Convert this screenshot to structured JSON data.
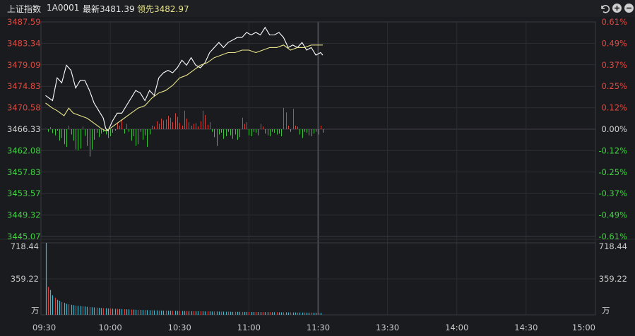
{
  "header": {
    "title": "上证指数",
    "code": "1A0001",
    "latest_label": "最新",
    "latest_value": "3481.39",
    "leading_label": "领先",
    "leading_value": "3482.97",
    "icons": [
      "undo-icon",
      "zoom-in-icon",
      "zoom-out-icon"
    ]
  },
  "chart_data": {
    "type": "line",
    "prev_close": 3466.33,
    "price_axis_labels": [
      "3487.59",
      "3483.34",
      "3479.09",
      "3474.83",
      "3470.58",
      "3466.33",
      "3462.08",
      "3457.83",
      "3453.57",
      "3449.32",
      "3445.07"
    ],
    "pct_axis_labels": [
      "0.61%",
      "0.49%",
      "0.37%",
      "0.25%",
      "0.12%",
      "0.00%",
      "-0.12%",
      "-0.25%",
      "-0.37%",
      "-0.49%",
      "-0.61%"
    ],
    "ylim": [
      3445.07,
      3487.59
    ],
    "volume_axis_labels": [
      "718.44",
      "359.22"
    ],
    "volume_unit": "万",
    "volume_ylim": [
      0,
      718.44
    ],
    "time_labels": [
      "09:30",
      "10:00",
      "10:30",
      "11:00",
      "11:30",
      "13:30",
      "14:00",
      "14:30",
      "15:00"
    ],
    "session_minutes": 240,
    "series": [
      {
        "color": "#ffffff",
        "points": [
          [
            0,
            3473.0
          ],
          [
            3,
            3472.0
          ],
          [
            5,
            3476.5
          ],
          [
            7,
            3475.5
          ],
          [
            9,
            3479.0
          ],
          [
            11,
            3478.0
          ],
          [
            13,
            3474.5
          ],
          [
            15,
            3476.0
          ],
          [
            17,
            3476.0
          ],
          [
            19,
            3474.0
          ],
          [
            21,
            3471.5
          ],
          [
            23,
            3470.0
          ],
          [
            25,
            3468.5
          ],
          [
            26,
            3466.5
          ],
          [
            27,
            3466.0
          ],
          [
            29,
            3468.0
          ],
          [
            31,
            3469.5
          ],
          [
            33,
            3469.5
          ],
          [
            35,
            3471.0
          ],
          [
            37,
            3472.5
          ],
          [
            39,
            3474.0
          ],
          [
            41,
            3473.5
          ],
          [
            43,
            3472.0
          ],
          [
            45,
            3474.0
          ],
          [
            47,
            3473.0
          ],
          [
            49,
            3476.5
          ],
          [
            51,
            3477.5
          ],
          [
            53,
            3478.0
          ],
          [
            55,
            3477.5
          ],
          [
            57,
            3478.5
          ],
          [
            59,
            3480.0
          ],
          [
            61,
            3479.0
          ],
          [
            63,
            3480.5
          ],
          [
            65,
            3479.0
          ],
          [
            67,
            3478.5
          ],
          [
            69,
            3479.5
          ],
          [
            71,
            3481.5
          ],
          [
            73,
            3482.5
          ],
          [
            75,
            3483.5
          ],
          [
            77,
            3482.5
          ],
          [
            79,
            3483.5
          ],
          [
            81,
            3484.0
          ],
          [
            83,
            3484.5
          ],
          [
            85,
            3484.5
          ],
          [
            87,
            3485.5
          ],
          [
            89,
            3485.0
          ],
          [
            91,
            3485.5
          ],
          [
            93,
            3485.0
          ],
          [
            95,
            3486.5
          ],
          [
            97,
            3485.0
          ],
          [
            99,
            3485.0
          ],
          [
            101,
            3485.5
          ],
          [
            103,
            3484.5
          ],
          [
            105,
            3482.5
          ],
          [
            107,
            3483.0
          ],
          [
            109,
            3482.5
          ],
          [
            111,
            3483.5
          ],
          [
            113,
            3482.0
          ],
          [
            115,
            3482.5
          ],
          [
            117,
            3481.0
          ],
          [
            119,
            3481.5
          ],
          [
            120,
            3481.0
          ]
        ]
      },
      {
        "color": "#e8e48c",
        "points": [
          [
            0,
            3471.5
          ],
          [
            3,
            3470.5
          ],
          [
            5,
            3470.0
          ],
          [
            8,
            3469.0
          ],
          [
            10,
            3470.5
          ],
          [
            12,
            3469.5
          ],
          [
            15,
            3469.0
          ],
          [
            18,
            3468.5
          ],
          [
            21,
            3467.5
          ],
          [
            24,
            3466.5
          ],
          [
            26,
            3466.0
          ],
          [
            28,
            3466.5
          ],
          [
            31,
            3467.5
          ],
          [
            34,
            3468.5
          ],
          [
            37,
            3469.5
          ],
          [
            40,
            3470.5
          ],
          [
            43,
            3471.0
          ],
          [
            46,
            3472.5
          ],
          [
            49,
            3473.5
          ],
          [
            52,
            3474.0
          ],
          [
            55,
            3475.0
          ],
          [
            58,
            3476.5
          ],
          [
            61,
            3477.0
          ],
          [
            64,
            3478.0
          ],
          [
            67,
            3479.0
          ],
          [
            70,
            3479.5
          ],
          [
            73,
            3480.5
          ],
          [
            76,
            3481.0
          ],
          [
            79,
            3481.5
          ],
          [
            82,
            3481.5
          ],
          [
            85,
            3482.0
          ],
          [
            88,
            3482.0
          ],
          [
            91,
            3481.5
          ],
          [
            94,
            3482.0
          ],
          [
            97,
            3482.5
          ],
          [
            100,
            3482.5
          ],
          [
            103,
            3483.0
          ],
          [
            106,
            3482.0
          ],
          [
            109,
            3482.5
          ],
          [
            112,
            3482.5
          ],
          [
            115,
            3483.0
          ],
          [
            118,
            3483.0
          ],
          [
            120,
            3483.0
          ]
        ]
      }
    ],
    "imbalance_bars": [
      -1.5,
      1.2,
      -2.2,
      -3.5,
      -0.8,
      -6.5,
      -5.0,
      -8.5,
      -10.0,
      2.0,
      -3.0,
      -6.5,
      -11.5,
      -12.0,
      -11.0,
      1.5,
      -3.8,
      -9.5,
      -15.5,
      -11.5,
      -6.0,
      -2.0,
      -4.5,
      -2.5,
      -1.5,
      -3.0,
      -5.0,
      -4.0,
      -2.0,
      -0.8,
      3.5,
      2.0,
      5.0,
      -2.5,
      3.0,
      -1.5,
      -6.5,
      -4.0,
      -9.5,
      -8.5,
      -1.5,
      -6.0,
      -3.5,
      -10.0,
      -3.0,
      2.0,
      1.5,
      4.5,
      3.0,
      6.0,
      5.0,
      5.5,
      7.5,
      6.5,
      4.0,
      9.0,
      7.0,
      3.5,
      2.0,
      10.5,
      6.0,
      4.0,
      2.0,
      3.0,
      3.5,
      1.5,
      4.5,
      10.5,
      8.0,
      2.5,
      4.0,
      -1.5,
      -4.5,
      -9.5,
      -3.0,
      -2.0,
      -5.5,
      -4.0,
      -1.5,
      -3.5,
      -5.5,
      -3.0,
      -6.0,
      -4.5,
      6.5,
      3.0,
      4.0,
      -3.5,
      -4.0,
      -1.5,
      -2.0,
      -3.5,
      3.0,
      1.5,
      -2.5,
      -3.5,
      -4.0,
      -1.5,
      -2.0,
      -3.0,
      -2.5,
      -4.0,
      12.0,
      9.5,
      2.0,
      -1.5,
      11.5,
      2.0,
      1.5,
      -3.0,
      -5.0,
      -1.5,
      -2.0,
      -3.5,
      -4.0,
      -2.5,
      -1.5,
      -3.0,
      2.0,
      -2.0
    ],
    "volume_bars": [
      718,
      278,
      248,
      195,
      170,
      150,
      140,
      128,
      120,
      110,
      105,
      100,
      96,
      92,
      90,
      88,
      85,
      83,
      80,
      78,
      76,
      74,
      72,
      70,
      68,
      67,
      66,
      64,
      62,
      61,
      60,
      59,
      58,
      57,
      56,
      55,
      54,
      53,
      52,
      51,
      50,
      49,
      48,
      48,
      47,
      46,
      45,
      45,
      44,
      43,
      43,
      42,
      42,
      41,
      41,
      40,
      40,
      39,
      39,
      38,
      38,
      37,
      37,
      36,
      36,
      36,
      35,
      35,
      35,
      34,
      34,
      34,
      33,
      33,
      33,
      32,
      32,
      32,
      31,
      31,
      31,
      30,
      30,
      30,
      30,
      29,
      29,
      29,
      29,
      28,
      28,
      28,
      28,
      27,
      27,
      27,
      27,
      26,
      26,
      26,
      26,
      25,
      25,
      25,
      25,
      24,
      24,
      24,
      24,
      23,
      23,
      23,
      23,
      22,
      22,
      22,
      22,
      21,
      21,
      21
    ]
  }
}
